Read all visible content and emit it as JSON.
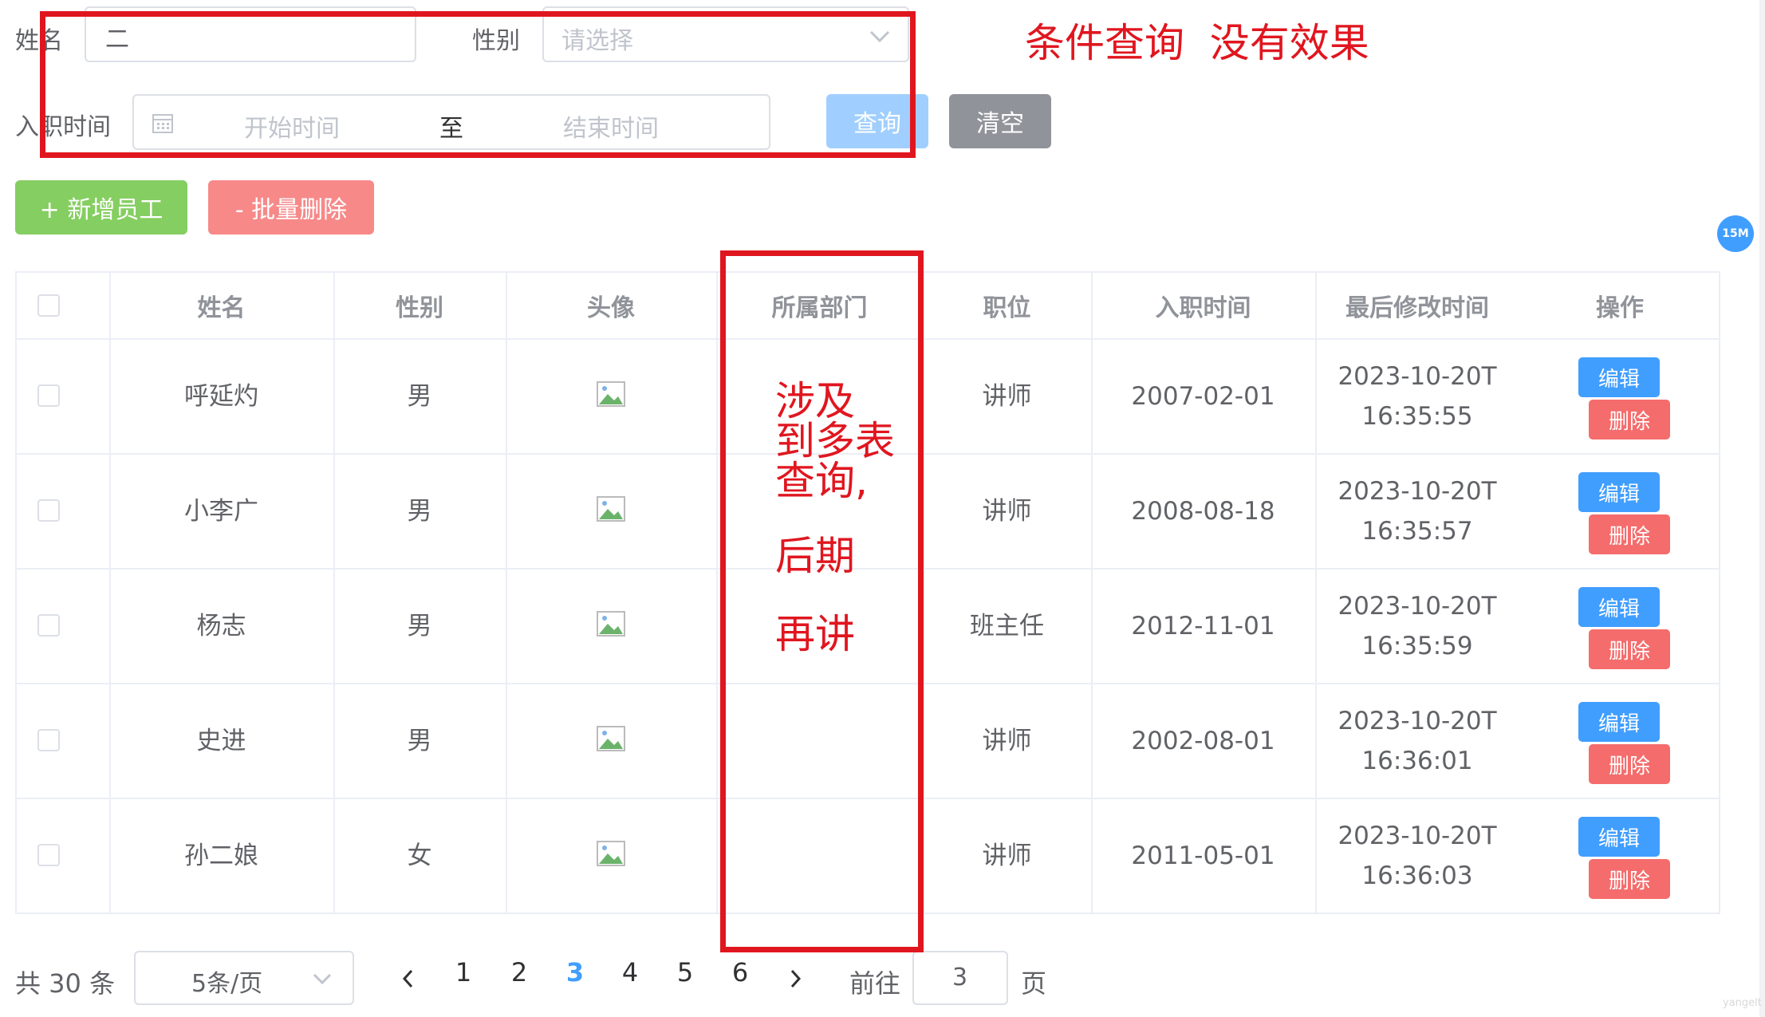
{
  "search": {
    "name_label": "姓名",
    "name_value": "二",
    "gender_label": "性别",
    "gender_placeholder": "请选择",
    "date_label": "入职时间",
    "date_start_placeholder": "开始时间",
    "date_separator": "至",
    "date_end_placeholder": "结束时间",
    "query_btn": "查询",
    "clear_btn": "清空"
  },
  "actions": {
    "add_btn": "+ 新增员工",
    "batch_delete_btn": "- 批量删除"
  },
  "table": {
    "headers": [
      "姓名",
      "性别",
      "头像",
      "所属部门",
      "职位",
      "入职时间",
      "最后修改时间",
      "操作"
    ],
    "rows": [
      {
        "name": "呼延灼",
        "gender": "男",
        "dept": "",
        "job": "讲师",
        "entry": "2007-02-01",
        "updated_date": "2023-10-20T",
        "updated_time": "16:35:55"
      },
      {
        "name": "小李广",
        "gender": "男",
        "dept": "",
        "job": "讲师",
        "entry": "2008-08-18",
        "updated_date": "2023-10-20T",
        "updated_time": "16:35:57"
      },
      {
        "name": "杨志",
        "gender": "男",
        "dept": "",
        "job": "班主任",
        "entry": "2012-11-01",
        "updated_date": "2023-10-20T",
        "updated_time": "16:35:59"
      },
      {
        "name": "史进",
        "gender": "男",
        "dept": "",
        "job": "讲师",
        "entry": "2002-08-01",
        "updated_date": "2023-10-20T",
        "updated_time": "16:36:01"
      },
      {
        "name": "孙二娘",
        "gender": "女",
        "dept": "",
        "job": "讲师",
        "entry": "2011-05-01",
        "updated_date": "2023-10-20T",
        "updated_time": "16:36:03"
      }
    ],
    "edit_label": "编辑",
    "delete_label": "删除"
  },
  "pagination": {
    "total": "共 30 条",
    "page_size": "5条/页",
    "pages": [
      "1",
      "2",
      "3",
      "4",
      "5",
      "6"
    ],
    "current_page": "3",
    "goto_label": "前往",
    "goto_value": "3",
    "page_suffix": "页"
  },
  "annotations": {
    "top": "条件查询  没有效果",
    "middle_line1": "涉及",
    "middle_line2": "到多表",
    "middle_line3": "查询,",
    "middle_line4": "后期",
    "middle_line5": "再讲"
  },
  "floating_badge": "15M",
  "watermark": "yangelt",
  "colors": {
    "primary": "#409eff",
    "success": "#67c23a",
    "danger": "#f56c6c",
    "info": "#909399",
    "annotation": "#e0161f"
  }
}
